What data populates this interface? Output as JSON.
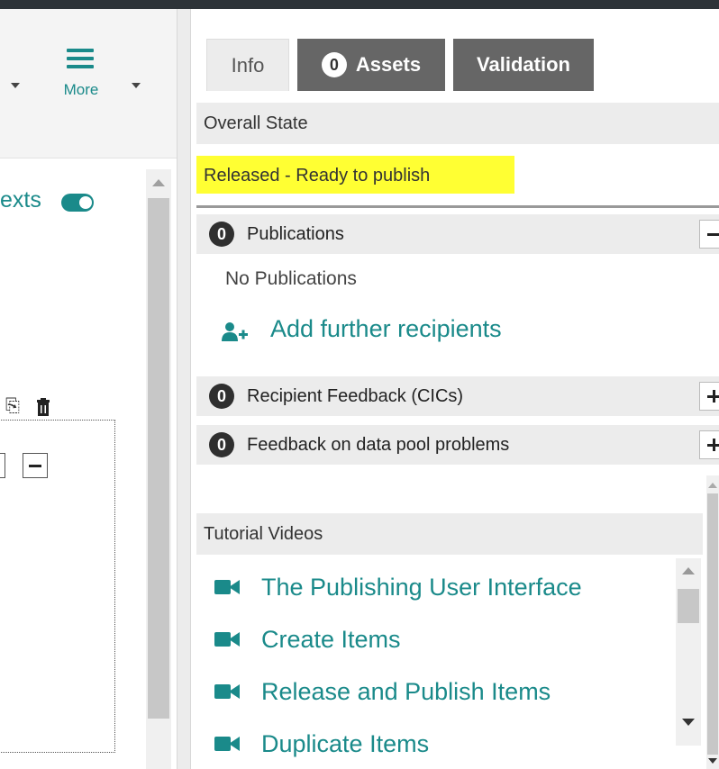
{
  "toolbar": {
    "more_label": "More"
  },
  "left_panel": {
    "texts_label": "exts"
  },
  "tabs": {
    "info": "Info",
    "assets_count": "0",
    "assets": "Assets",
    "validation": "Validation"
  },
  "overall_state": {
    "heading": "Overall State",
    "value": "Released - Ready to publish",
    "highlight_color": "#ffff33"
  },
  "publications": {
    "count": "0",
    "label": "Publications",
    "empty_text": "No Publications",
    "add_recipients": "Add further recipients"
  },
  "recipient_feedback": {
    "count": "0",
    "label": "Recipient Feedback (CICs)"
  },
  "datapool_feedback": {
    "count": "0",
    "label": "Feedback on data pool problems"
  },
  "tutorials": {
    "heading": "Tutorial Videos",
    "videos": [
      {
        "label": "The Publishing User Interface"
      },
      {
        "label": "Create Items"
      },
      {
        "label": "Release and Publish Items"
      },
      {
        "label": "Duplicate Items"
      }
    ]
  },
  "colors": {
    "accent": "#1a8a8a",
    "tab_dark": "#666666",
    "panel_gray": "#ececec"
  }
}
